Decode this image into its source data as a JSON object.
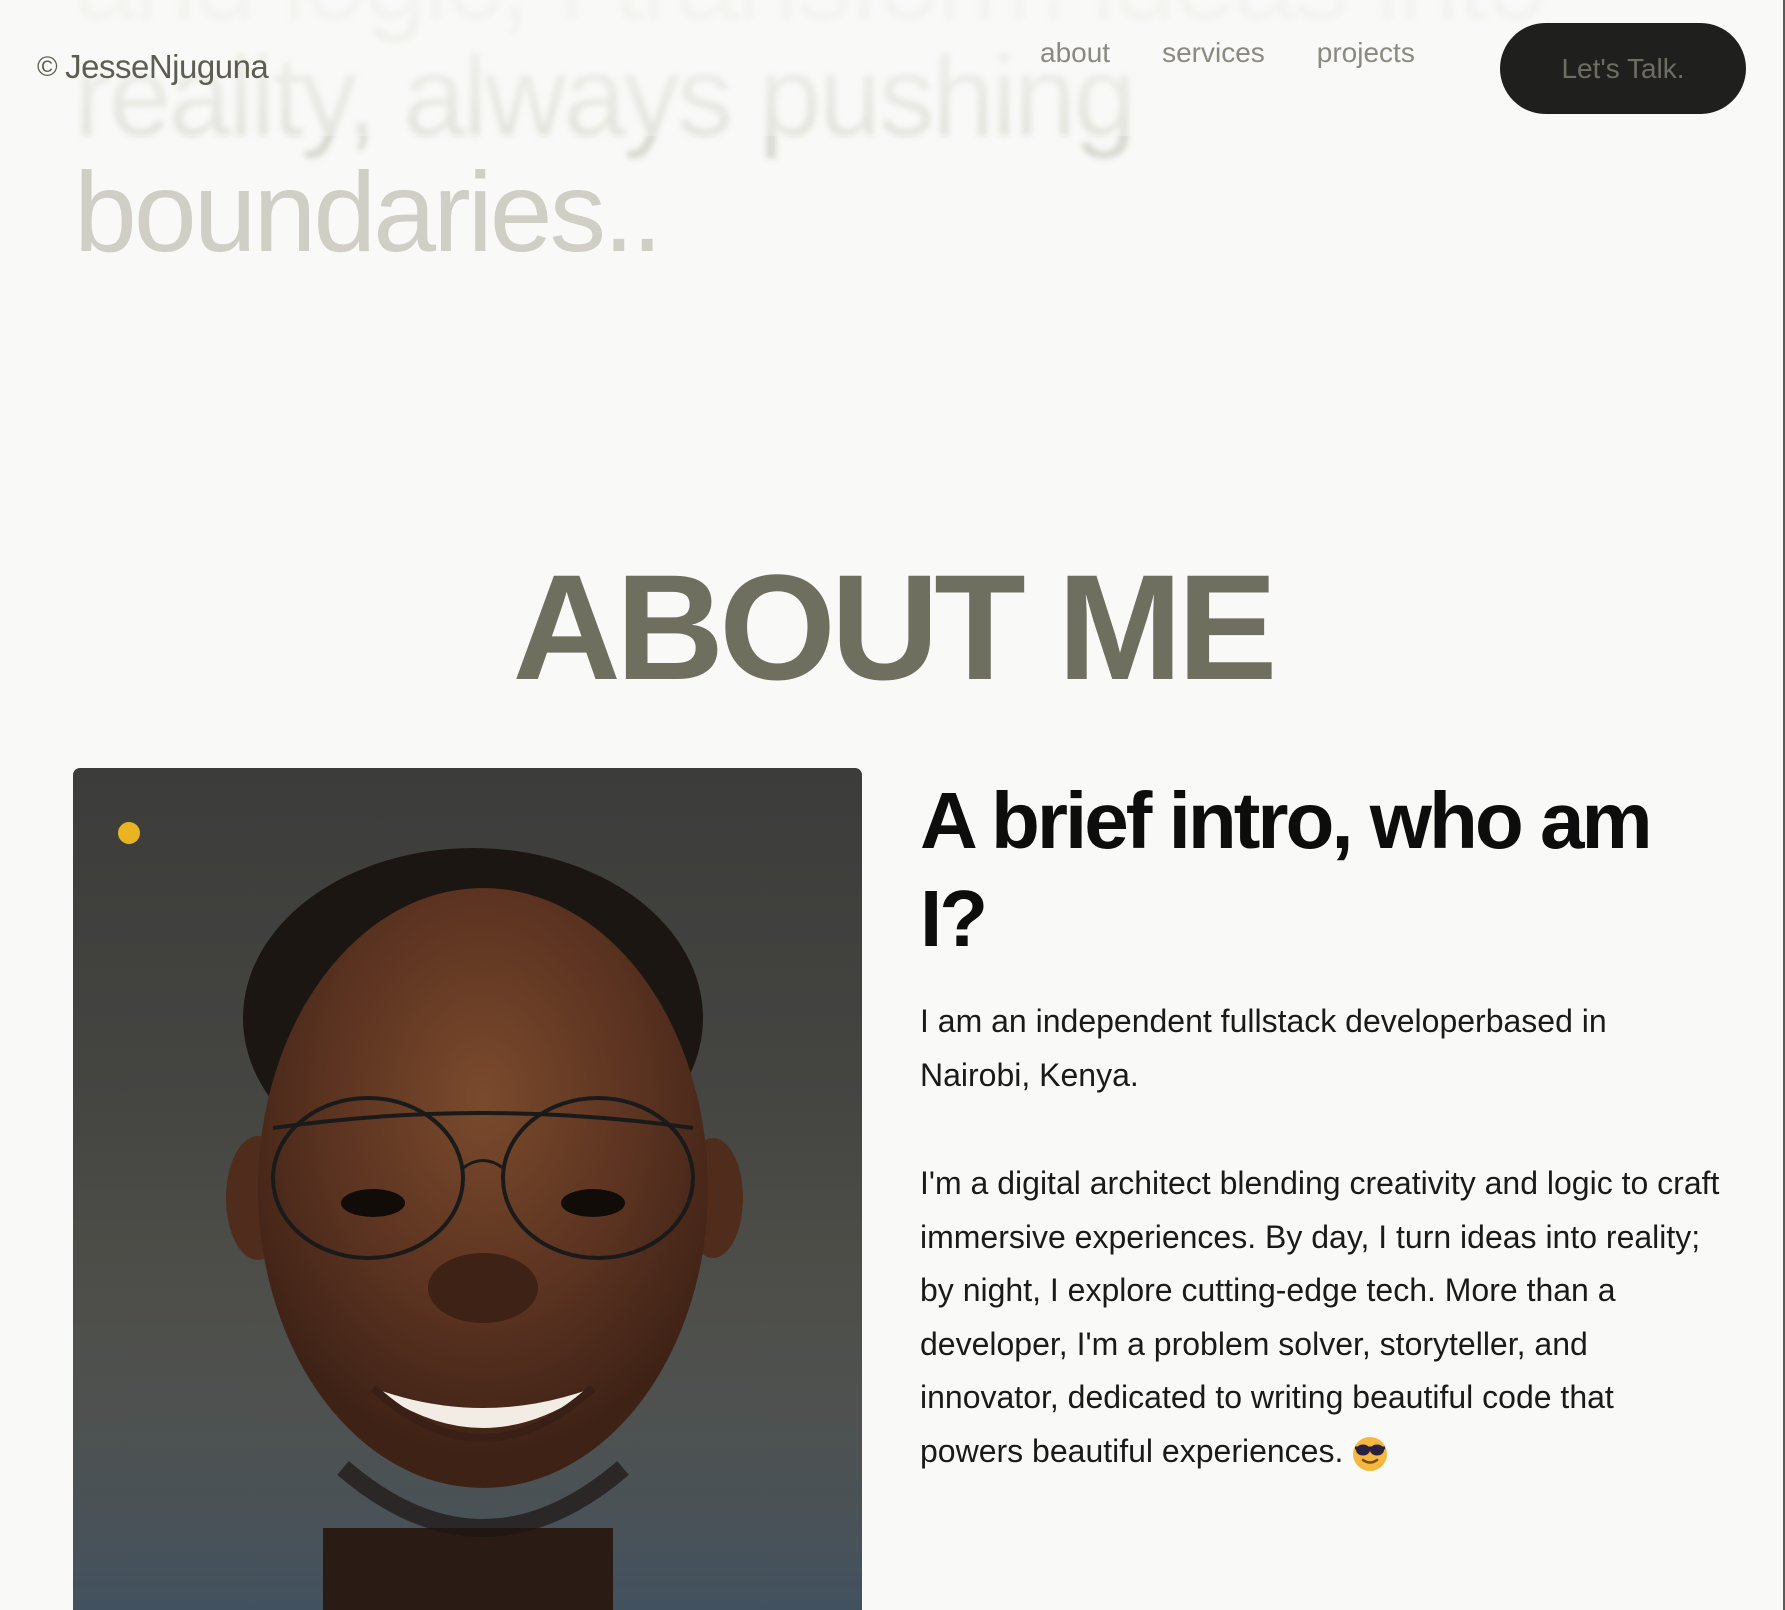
{
  "hero": {
    "lines": [
      "and logic, I transform ideas into",
      "reality, always pushing",
      "boundaries.."
    ]
  },
  "nav": {
    "brand": "JesseNjuguna",
    "brand_symbol": "©",
    "links": [
      "about",
      "services",
      "projects"
    ],
    "cta_label": "Let's Talk."
  },
  "about": {
    "title": "ABOUT ME",
    "intro_title": "A brief intro, who am I?",
    "paragraph_1": "I am an independent fullstack developerbased in Nairobi, Kenya.",
    "paragraph_2": "I'm a digital architect blending creativity and logic to craft immersive experiences. By day, I turn ideas into reality; by night, I explore cutting-edge tech. More than a developer, I'm a problem solver, storyteller, and innovator, dedicated to writing beautiful code that powers beautiful experiences.",
    "emoji": "sunglasses-face-icon"
  },
  "colors": {
    "background": "#f9f9f7",
    "accent_olive": "#6f6f5f",
    "hero_text": "#cfcfc6",
    "cta_bg": "#1f1f1e",
    "dot_yellow": "#e8b421"
  }
}
